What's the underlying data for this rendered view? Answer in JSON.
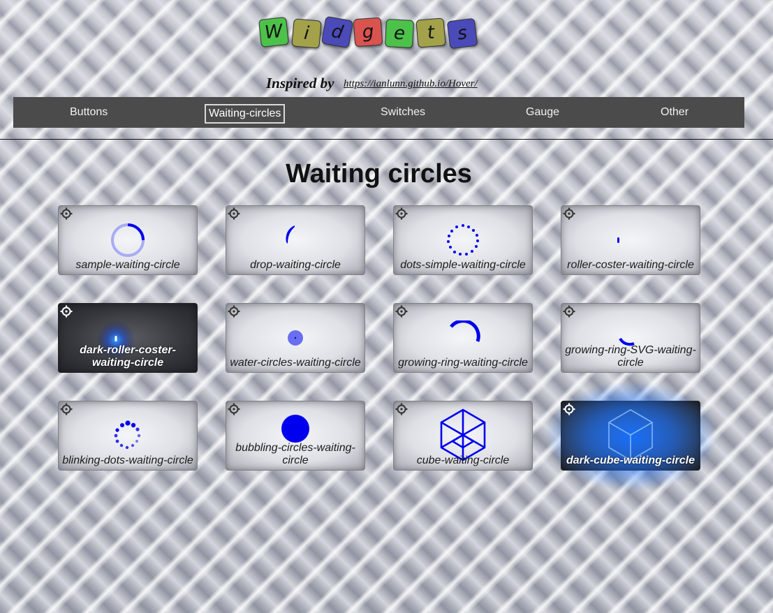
{
  "logo": {
    "letters": [
      {
        "char": "W",
        "color": "#4cc24a"
      },
      {
        "char": "i",
        "color": "#a3a14a"
      },
      {
        "char": "d",
        "color": "#4a4ab8"
      },
      {
        "char": "g",
        "color": "#d9534f"
      },
      {
        "char": "e",
        "color": "#4cc24a"
      },
      {
        "char": "t",
        "color": "#a3a14a"
      },
      {
        "char": "s",
        "color": "#4a4ab8"
      }
    ]
  },
  "inspired": {
    "text": "Inspired by",
    "link": "https://ianlunn.github.io/Hover/"
  },
  "nav": {
    "items": [
      {
        "label": "Buttons"
      },
      {
        "label": "Waiting-circles"
      },
      {
        "label": "Switches"
      },
      {
        "label": "Gauge"
      },
      {
        "label": "Other"
      }
    ],
    "active": "Waiting-circles"
  },
  "page_title": "Waiting circles",
  "cards": [
    {
      "label": "sample-waiting-circle",
      "dark": false
    },
    {
      "label": "drop-waiting-circle",
      "dark": false
    },
    {
      "label": "dots-simple-waiting-circle",
      "dark": false
    },
    {
      "label": "roller-coster-waiting-circle",
      "dark": false
    },
    {
      "label": "dark-roller-coster-waiting-circle",
      "dark": true
    },
    {
      "label": "water-circles-waiting-circle",
      "dark": false
    },
    {
      "label": "growing-ring-waiting-circle",
      "dark": false
    },
    {
      "label": "growing-ring-SVG-waiting-circle",
      "dark": false
    },
    {
      "label": "blinking-dots-waiting-circle",
      "dark": false
    },
    {
      "label": "bubbling-circles-waiting-circle",
      "dark": false
    },
    {
      "label": "cube-waiting-circle",
      "dark": false
    },
    {
      "label": "dark-cube-waiting-circle",
      "dark": true
    }
  ],
  "icons": {
    "settings": "gear-icon"
  },
  "colors": {
    "accent_blue": "#0000ee",
    "nav_bg": "#4b4b4b",
    "glow_blue": "#1e6eff"
  }
}
